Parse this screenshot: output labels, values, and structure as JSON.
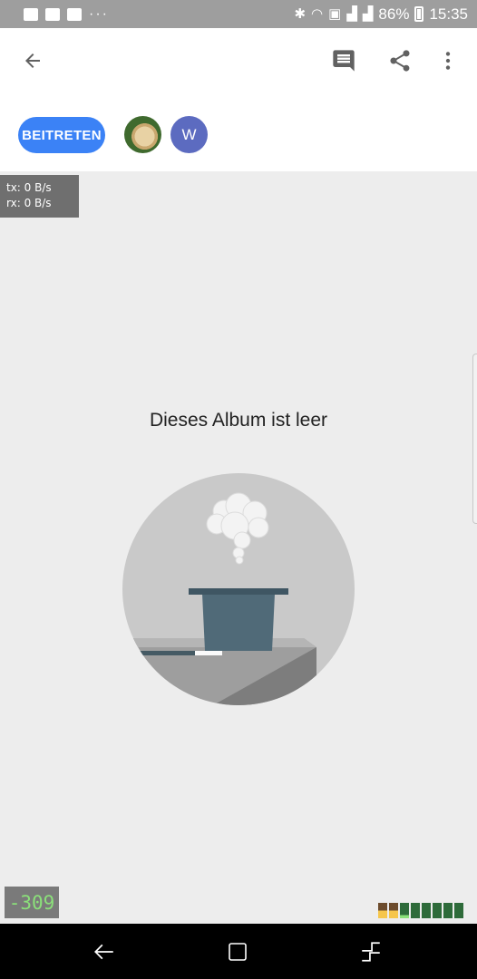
{
  "status_bar": {
    "battery": "86%",
    "time": "15:35",
    "dots": "···"
  },
  "appbar": {
    "back_icon": "arrow-back-icon",
    "comment_icon": "comment-icon",
    "share_icon": "share-icon",
    "more_icon": "more-vert-icon"
  },
  "join_button": {
    "label": "BEITRETEN"
  },
  "avatars": [
    {
      "type": "photo",
      "name": "dog-photo"
    },
    {
      "type": "initial",
      "letter": "W"
    }
  ],
  "overlay": {
    "tx": "tx: 0 B/s",
    "rx": "rx: 0 B/s",
    "counter": "-309"
  },
  "empty_state": {
    "title": "Dieses Album ist leer",
    "illustration": "magic-hat-illustration"
  },
  "colors": {
    "accent": "#3b82f6",
    "avatar_w": "#5c6bc0",
    "background": "#ededed"
  }
}
